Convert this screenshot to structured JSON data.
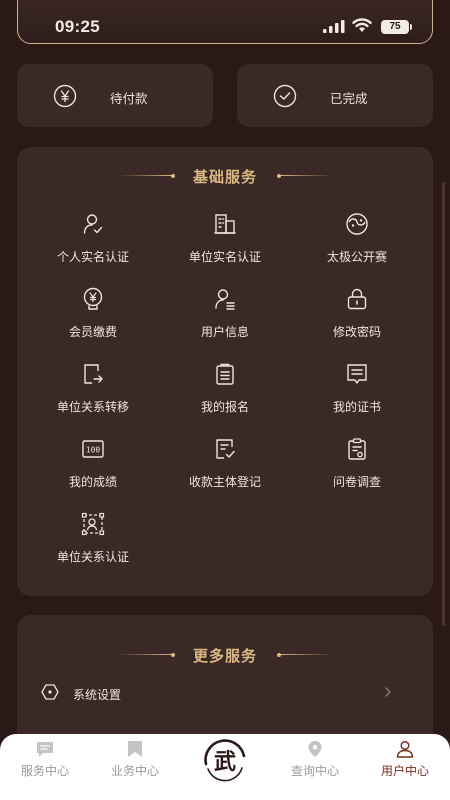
{
  "status_bar": {
    "time": "09:25",
    "battery": "75",
    "icons": [
      "signal-icon",
      "wifi-icon",
      "battery-icon"
    ]
  },
  "orders": [
    {
      "label": "待付款",
      "icon": "yen-circle-icon"
    },
    {
      "label": "已完成",
      "icon": "check-circle-icon"
    }
  ],
  "basic_services": {
    "title": "基础服务",
    "items": [
      {
        "label": "个人实名认证",
        "icon": "person-verify-icon"
      },
      {
        "label": "单位实名认证",
        "icon": "building-icon"
      },
      {
        "label": "太极公开赛",
        "icon": "taiji-icon"
      },
      {
        "label": "会员缴费",
        "icon": "yen-badge-icon"
      },
      {
        "label": "用户信息",
        "icon": "user-info-icon"
      },
      {
        "label": "修改密码",
        "icon": "lock-icon"
      },
      {
        "label": "单位关系转移",
        "icon": "transfer-icon"
      },
      {
        "label": "我的报名",
        "icon": "clipboard-icon"
      },
      {
        "label": "我的证书",
        "icon": "certificate-icon"
      },
      {
        "label": "我的成绩",
        "icon": "score-icon"
      },
      {
        "label": "收款主体登记",
        "icon": "register-icon"
      },
      {
        "label": "问卷调查",
        "icon": "survey-icon"
      },
      {
        "label": "单位关系认证",
        "icon": "relation-verify-icon"
      }
    ]
  },
  "more_services": {
    "title": "更多服务",
    "items": [
      {
        "label": "系统设置",
        "icon": "settings-icon"
      }
    ]
  },
  "tabbar": {
    "tabs": [
      {
        "label": "服务中心",
        "icon": "chat-icon",
        "active": false
      },
      {
        "label": "业务中心",
        "icon": "bookmark-icon",
        "active": false
      },
      {
        "label": "查询中心",
        "icon": "location-icon",
        "active": false
      },
      {
        "label": "用户中心",
        "icon": "user-icon",
        "active": true
      }
    ],
    "center_logo": "武"
  },
  "colors": {
    "background": "#2a1917",
    "card": "#3a2927",
    "accent_gold": "#d9b882",
    "active_tab": "#7a2e1e"
  }
}
